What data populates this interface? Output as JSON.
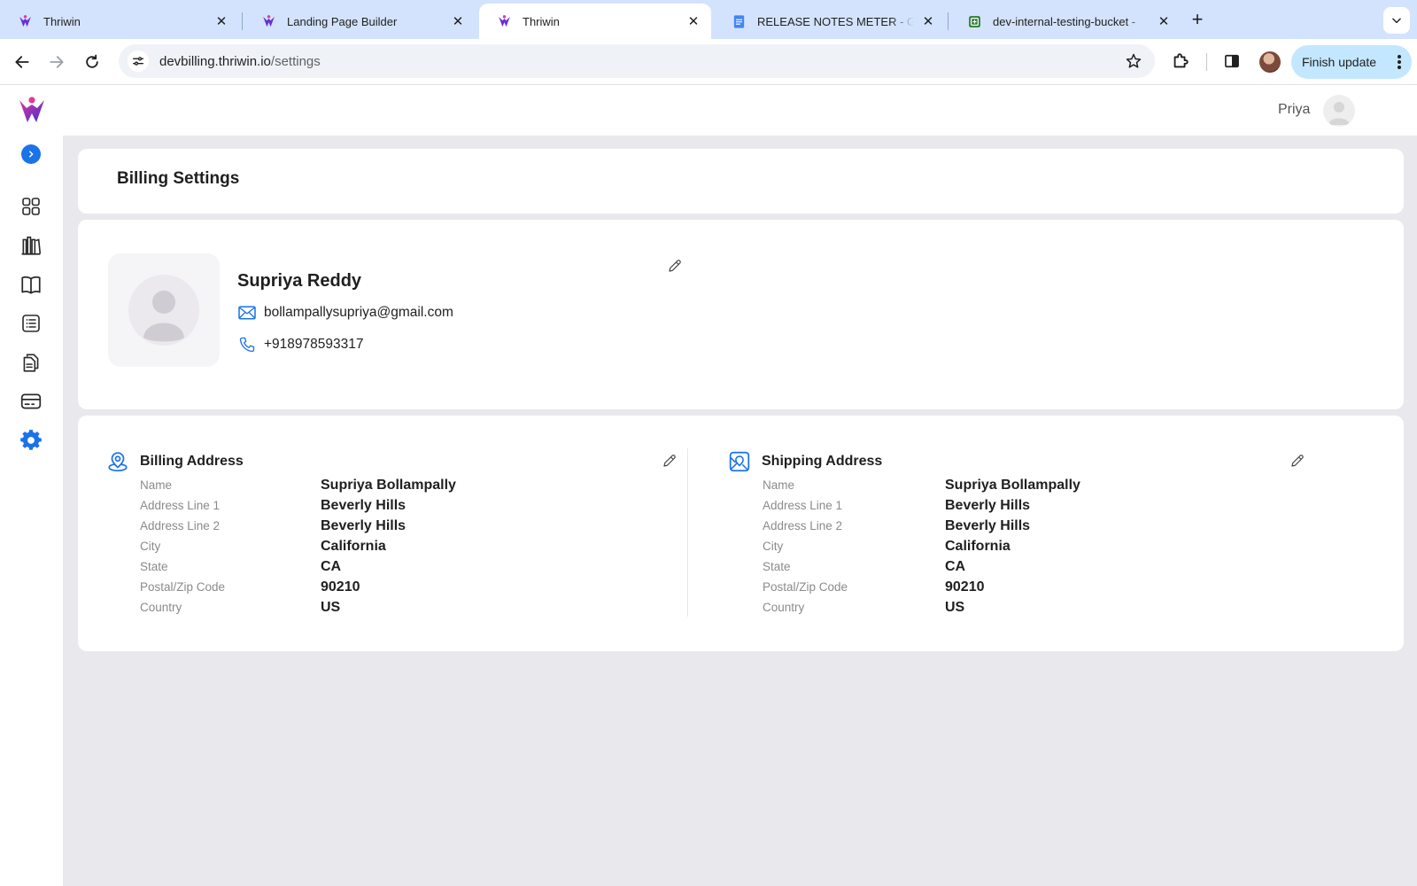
{
  "browser": {
    "tabs": [
      {
        "title": "Thriwin",
        "favicon": "thriwin-logo-icon",
        "active": false
      },
      {
        "title": "Landing Page Builder",
        "favicon": "thriwin-logo-icon",
        "active": false
      },
      {
        "title": "Thriwin",
        "favicon": "thriwin-logo-icon",
        "active": true
      },
      {
        "title": "RELEASE NOTES METER - Go",
        "favicon": "google-docs-icon",
        "active": false
      },
      {
        "title": "dev-internal-testing-bucket -",
        "favicon": "sheets-icon",
        "active": false
      }
    ],
    "url_host": "devbilling.thriwin.io",
    "url_path": "/settings",
    "finish_update_label": "Finish update"
  },
  "header": {
    "user_name": "Priya"
  },
  "sidebar": {
    "items": [
      {
        "name": "dashboard-grid-icon"
      },
      {
        "name": "library-icon"
      },
      {
        "name": "book-icon"
      },
      {
        "name": "list-icon"
      },
      {
        "name": "documents-icon"
      },
      {
        "name": "card-icon"
      },
      {
        "name": "settings-gear-icon",
        "active": true
      }
    ]
  },
  "page": {
    "title": "Billing Settings"
  },
  "profile": {
    "name": "Supriya Reddy",
    "email": "bollampallysupriya@gmail.com",
    "phone": "+918978593317"
  },
  "billing_address": {
    "heading": "Billing Address",
    "rows": [
      {
        "label": "Name",
        "value": "Supriya Bollampally"
      },
      {
        "label": "Address Line 1",
        "value": "Beverly Hills"
      },
      {
        "label": "Address Line 2",
        "value": "Beverly Hills"
      },
      {
        "label": "City",
        "value": "California"
      },
      {
        "label": "State",
        "value": "CA"
      },
      {
        "label": "Postal/Zip Code",
        "value": "90210"
      },
      {
        "label": "Country",
        "value": "US"
      }
    ]
  },
  "shipping_address": {
    "heading": "Shipping Address",
    "rows": [
      {
        "label": "Name",
        "value": "Supriya Bollampally"
      },
      {
        "label": "Address Line 1",
        "value": "Beverly Hills"
      },
      {
        "label": "Address Line 2",
        "value": "Beverly Hills"
      },
      {
        "label": "City",
        "value": "California"
      },
      {
        "label": "State",
        "value": "CA"
      },
      {
        "label": "Postal/Zip Code",
        "value": "90210"
      },
      {
        "label": "Country",
        "value": "US"
      }
    ]
  },
  "colors": {
    "accent": "#1a73e8",
    "brand_purple": "#6b2fd6",
    "tabbar_bg": "#d3e3fd",
    "content_bg": "#e9e8ec"
  }
}
